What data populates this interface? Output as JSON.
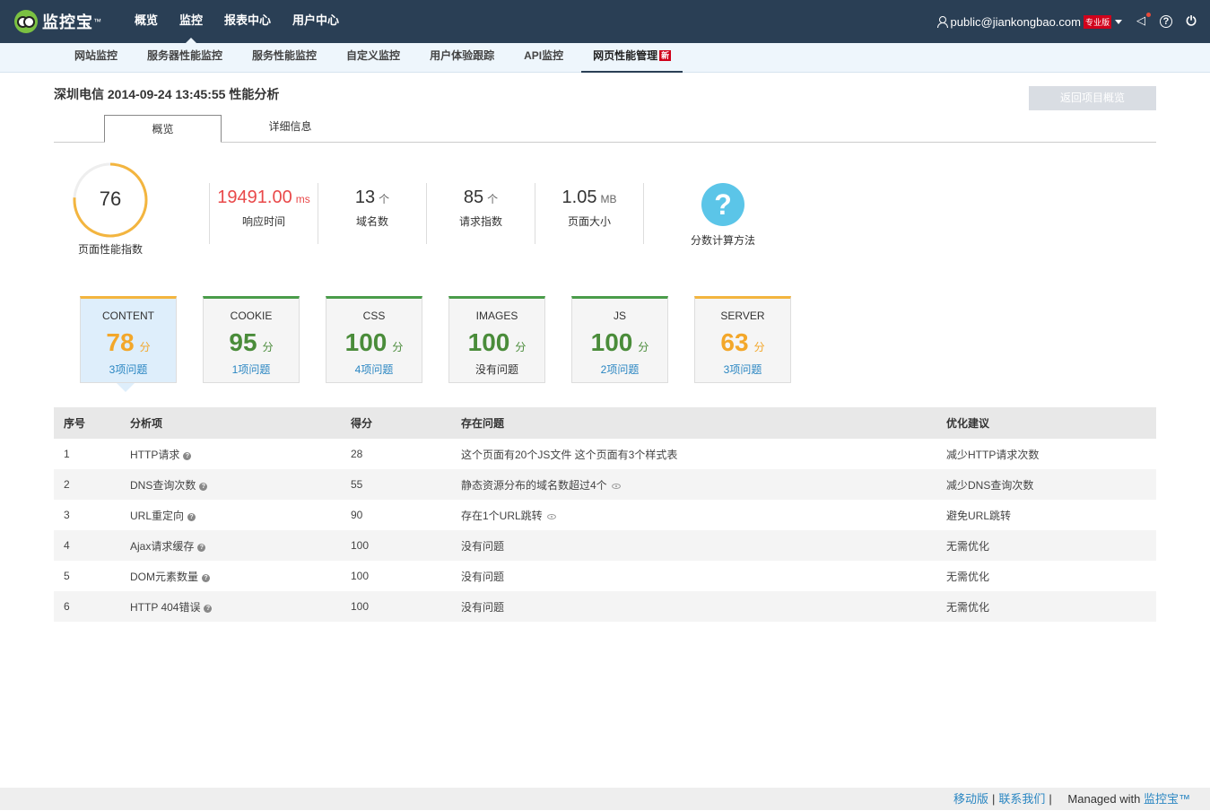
{
  "brand": {
    "name": "监控宝",
    "tm": "™"
  },
  "main_nav": [
    "概览",
    "监控",
    "报表中心",
    "用户中心"
  ],
  "user": {
    "email": "public@jiankongbao.com",
    "badge": "专业版"
  },
  "sub_nav": [
    "网站监控",
    "服务器性能监控",
    "服务性能监控",
    "自定义监控",
    "用户体验跟踪",
    "API监控",
    "网页性能管理"
  ],
  "sub_nav_new_badge": "新",
  "page_title": "深圳电信 2014-09-24 13:45:55 性能分析",
  "back_button": "返回项目概览",
  "tabs": [
    "概览",
    "详细信息"
  ],
  "score": {
    "value": "76",
    "label": "页面性能指数",
    "fraction": 0.76
  },
  "stats": [
    {
      "value": "19491.00",
      "unit": "ms",
      "label": "响应时间"
    },
    {
      "value": "13",
      "unit": "个",
      "label": "域名数"
    },
    {
      "value": "85",
      "unit": "个",
      "label": "请求指数"
    },
    {
      "value": "1.05",
      "unit": "MB",
      "label": "页面大小"
    }
  ],
  "score_method": {
    "symbol": "?",
    "label": "分数计算方法"
  },
  "score_unit": "分",
  "categories": [
    {
      "name": "CONTENT",
      "score": "78",
      "issues": "3项问题"
    },
    {
      "name": "COOKIE",
      "score": "95",
      "issues": "1项问题"
    },
    {
      "name": "CSS",
      "score": "100",
      "issues": "4项问题"
    },
    {
      "name": "IMAGES",
      "score": "100",
      "issues": "没有问题"
    },
    {
      "name": "JS",
      "score": "100",
      "issues": "2项问题"
    },
    {
      "name": "SERVER",
      "score": "63",
      "issues": "3项问题"
    }
  ],
  "table": {
    "headers": [
      "序号",
      "分析项",
      "得分",
      "存在问题",
      "优化建议"
    ],
    "rows": [
      {
        "no": "1",
        "item": "HTTP请求",
        "score": "28",
        "issue": "这个页面有20个JS文件 这个页面有3个样式表",
        "advice": "减少HTTP请求次数"
      },
      {
        "no": "2",
        "item": "DNS查询次数",
        "score": "55",
        "issue": "静态资源分布的域名数超过4个",
        "advice": "减少DNS查询次数"
      },
      {
        "no": "3",
        "item": "URL重定向",
        "score": "90",
        "issue": "存在1个URL跳转",
        "advice": "避免URL跳转"
      },
      {
        "no": "4",
        "item": "Ajax请求缓存",
        "score": "100",
        "issue": "没有问题",
        "advice": "无需优化"
      },
      {
        "no": "5",
        "item": "DOM元素数量",
        "score": "100",
        "issue": "没有问题",
        "advice": "无需优化"
      },
      {
        "no": "6",
        "item": "HTTP 404错误",
        "score": "100",
        "issue": "没有问题",
        "advice": "无需优化"
      }
    ]
  },
  "footer": {
    "mobile": "移动版",
    "contact": "联系我们",
    "managed": "Managed with",
    "brand": "监控宝™"
  }
}
